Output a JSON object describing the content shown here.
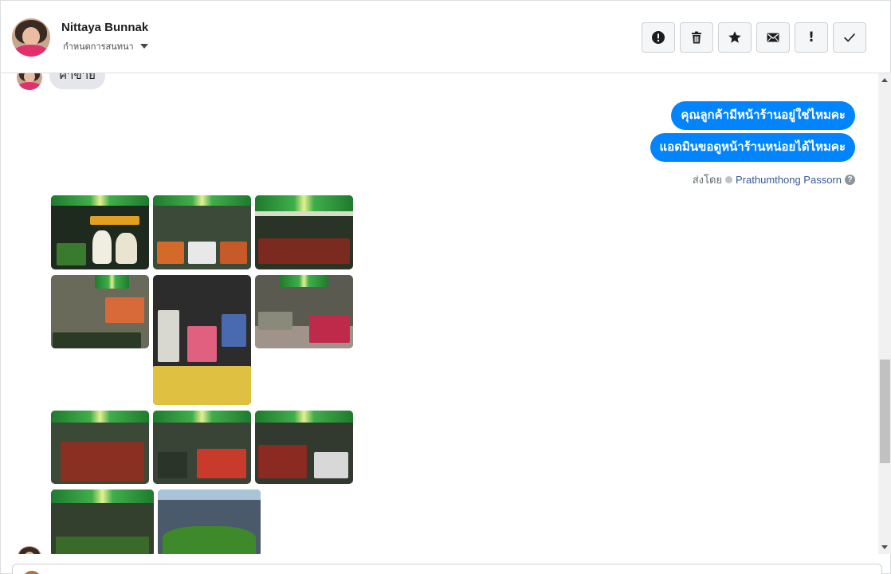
{
  "header": {
    "contact_name": "Nittaya Bunnak",
    "assign_label": "กำหนดการสนทนา",
    "actions": [
      {
        "name": "spam",
        "icon": "exclamation-circle-icon"
      },
      {
        "name": "delete",
        "icon": "trash-icon"
      },
      {
        "name": "star",
        "icon": "star-icon"
      },
      {
        "name": "mark-unread",
        "icon": "envelope-icon"
      },
      {
        "name": "follow-up",
        "icon": "exclamation-icon",
        "glyph": "!"
      },
      {
        "name": "mark-done",
        "icon": "check-icon"
      }
    ]
  },
  "conversation": {
    "incoming_partial_text": "ค่าขาย",
    "outgoing_messages": [
      "คุณลูกค้ามีหน้าร้านอยู่ใช่ไหมคะ",
      "แอดมินขอดูหน้าร้านหน่อยได้ไหมคะ"
    ],
    "sent_by_label": "ส่งโดย",
    "sent_by_agent": "Prathumthong Passorn",
    "help_glyph": "?",
    "photo_count": 11
  },
  "colors": {
    "outgoing_bubble": "#0084ff",
    "incoming_bubble": "#e4e6eb",
    "agent_link": "#385898"
  }
}
